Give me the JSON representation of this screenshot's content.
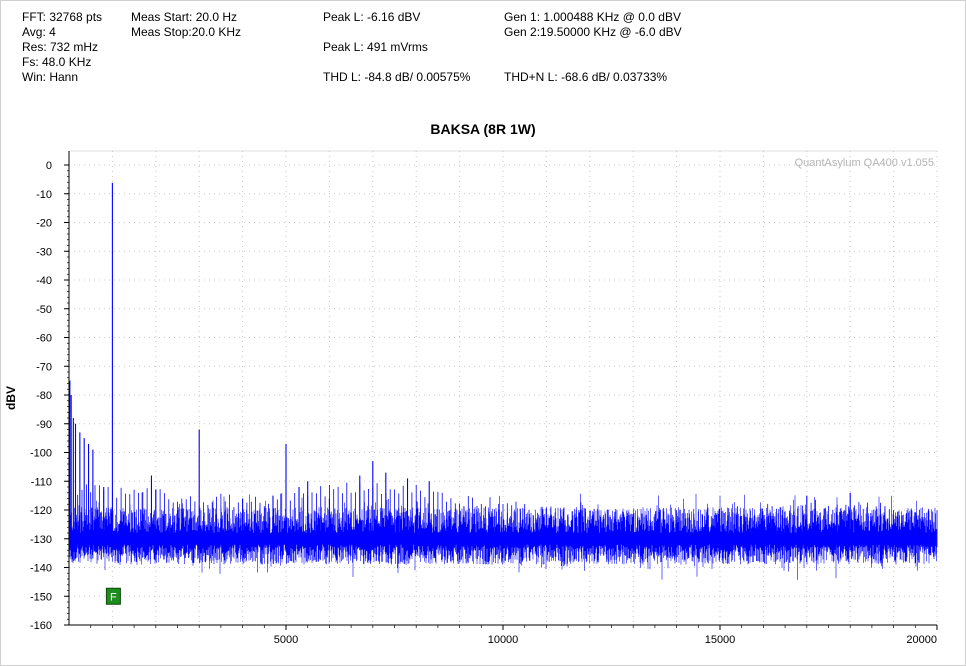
{
  "header": {
    "col1": [
      "FFT: 32768 pts",
      "Avg: 4",
      "Res: 732 mHz",
      "Fs: 48.0 KHz",
      "Win: Hann"
    ],
    "col2": [
      "Meas Start: 20.0 Hz",
      "Meas Stop:20.0 KHz"
    ],
    "col3": [
      "Peak L: -6.16 dBV",
      "Peak L: 491 mVrms",
      "THD L: -84.8 dB/ 0.00575%"
    ],
    "col4": [
      "Gen 1: 1.000488 KHz @ 0.0  dBV",
      "Gen 2:19.50000 KHz @ -6.0  dBV",
      "THD+N L: -68.6 dB/ 0.03733%"
    ]
  },
  "watermark": "QuantAsylum QA400 v1.055",
  "marker_label": "F",
  "colors": {
    "trace": "#0000ff",
    "grid": "#c8c8c8",
    "marker": "#1e8c1e"
  },
  "chart_data": {
    "type": "line",
    "title": "BAKSA (8R 1W)",
    "xlabel": "",
    "ylabel": "dBV",
    "xlim": [
      0,
      20000
    ],
    "ylim": [
      -160,
      0
    ],
    "xticks": [
      5000,
      10000,
      15000,
      20000
    ],
    "yticks": [
      0,
      -10,
      -20,
      -30,
      -40,
      -50,
      -60,
      -70,
      -80,
      -90,
      -100,
      -110,
      -120,
      -130,
      -140,
      -150,
      -160
    ],
    "grid": true,
    "noise_floor": -130,
    "peaks": [
      {
        "x": 1000,
        "y": -6.2
      },
      {
        "x": 3000,
        "y": -92
      },
      {
        "x": 5000,
        "y": -97
      },
      {
        "x": 7000,
        "y": -103
      },
      {
        "x": 2000,
        "y": -113
      },
      {
        "x": 4000,
        "y": -116
      },
      {
        "x": 6000,
        "y": -116
      },
      {
        "x": 20,
        "y": -75
      },
      {
        "x": 50,
        "y": -80
      },
      {
        "x": 100,
        "y": -88
      },
      {
        "x": 150,
        "y": -90
      },
      {
        "x": 250,
        "y": -93
      },
      {
        "x": 350,
        "y": -95
      },
      {
        "x": 450,
        "y": -97
      },
      {
        "x": 550,
        "y": -99
      },
      {
        "x": 800,
        "y": -112
      },
      {
        "x": 1900,
        "y": -108
      },
      {
        "x": 4700,
        "y": -115
      },
      {
        "x": 5300,
        "y": -112
      },
      {
        "x": 5500,
        "y": -110
      },
      {
        "x": 6700,
        "y": -108
      },
      {
        "x": 7300,
        "y": -107
      },
      {
        "x": 7800,
        "y": -109
      },
      {
        "x": 8300,
        "y": -110
      },
      {
        "x": 17000,
        "y": -115
      },
      {
        "x": 18000,
        "y": -114
      }
    ],
    "sidebands": {
      "spacing": 100,
      "start": 200,
      "end": 20000,
      "envelope_db": [
        [
          200,
          -110
        ],
        [
          4000,
          -115
        ],
        [
          7000,
          -109
        ],
        [
          11000,
          -118
        ],
        [
          14000,
          -120
        ],
        [
          17500,
          -116
        ],
        [
          20000,
          -118
        ]
      ]
    },
    "marker": {
      "x": 1000,
      "y": -150
    }
  }
}
